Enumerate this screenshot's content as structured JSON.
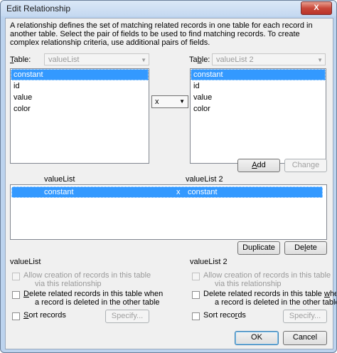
{
  "window": {
    "title": "Edit Relationship",
    "close_label": "X"
  },
  "description": "A relationship defines the set of matching related records in one table for each record in another table. Select the pair of fields to be used to find matching records. To create complex relationship criteria, use additional pairs of fields.",
  "left": {
    "table_label_pre": "T",
    "table_label_post": "able:",
    "table_value": "valueList",
    "fields": [
      "constant",
      "id",
      "value",
      "color"
    ],
    "selected_index": 0
  },
  "right": {
    "table_label_pre": "Ta",
    "table_label_u": "b",
    "table_label_post": "le:",
    "table_value": "valueList 2",
    "fields": [
      "constant",
      "id",
      "value",
      "color"
    ],
    "selected_index": 0
  },
  "operator": "x",
  "buttons": {
    "add": "Add",
    "add_u": "A",
    "add_rest": "dd",
    "change": "Change",
    "duplicate": "Duplicate",
    "delete": "Delete",
    "delete_pre": "De",
    "delete_u": "l",
    "delete_post": "ete",
    "ok": "OK",
    "cancel": "Cancel"
  },
  "pairs": {
    "left_header": "valueList",
    "right_header": "valueList 2",
    "rows": [
      {
        "left": "constant",
        "op": "x",
        "right": "constant"
      }
    ]
  },
  "options": {
    "left_title": "valueList",
    "right_title": "valueList 2",
    "allow_creation": "Allow creation of records in this table",
    "via": "via this relationship",
    "delete_related_1": "elete related records in this table when",
    "delete_related_u": "D",
    "delete_related_2": "a record is deleted in the other table",
    "right_delete_pre": "Delete related records in this table ",
    "right_delete_u": "w",
    "right_delete_post": "hen",
    "sort_u": "S",
    "sort_rest": "ort records",
    "sort_right_pre": "Sort reco",
    "sort_right_u": "r",
    "sort_right_post": "ds",
    "specify": "Specify..."
  }
}
